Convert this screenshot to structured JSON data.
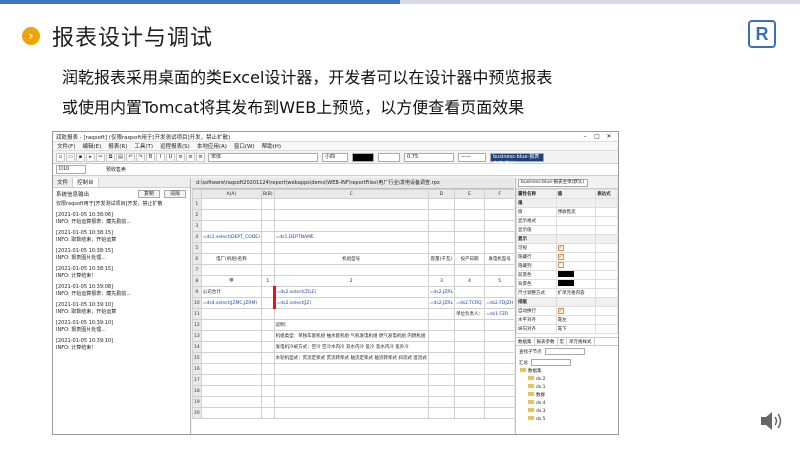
{
  "slide": {
    "title": "报表设计与调试",
    "line1": "润乾报表采用桌面的类Excel设计器，开发者可以在设计器中预览报表",
    "line2": "或使用内置Tomcat将其发布到WEB上预览，以方便查看页面效果",
    "logo_letter": "R",
    "bullet_icon": "chevron-right"
  },
  "app": {
    "title": "润乾报表 - [raqsoft] (仅限raqsoft用于[开发测试项目]开发，禁止扩散)",
    "menu": [
      "文件(F)",
      "编辑(E)",
      "报表(R)",
      "工具(T)",
      "远程报表(S)",
      "本地应用(A)",
      "窗口(W)",
      "帮助(H)"
    ],
    "font": "宋体",
    "font_size": "小四",
    "line_width": "0.75",
    "cell_ref": "D10",
    "formula_text": "预收售卖",
    "left_tabs": [
      "文件",
      "控制台"
    ],
    "system_output": "系统信息输出",
    "copy_btn": "复制",
    "clear_btn": "清除",
    "log_intro": "仅限raqsoft用于[开发测试项目]开发，禁止扩散",
    "log": [
      {
        "time": "[2021-01-05 10:38:06]",
        "msg": "INFO: 开始运算报表：藏先勤前..."
      },
      {
        "time": "[2021-01-05 10:38:15]",
        "msg": "INFO: 取数结束，开始运算"
      },
      {
        "time": "[2021-01-05 10:38:15]",
        "msg": "INFO: 报表图片处理..."
      },
      {
        "time": "[2021-01-05 10:38:15]",
        "msg": "INFO: 计算结束！"
      },
      {
        "time": "[2021-01-05 10:39:08]",
        "msg": "INFO: 开始运算报表：藏先勤前..."
      },
      {
        "time": "[2021-01-05 10:39:10]",
        "msg": "INFO: 取数结束，开始运算"
      },
      {
        "time": "[2021-01-05 10:39:10]",
        "msg": "INFO: 报表图片处理..."
      },
      {
        "time": "[2021-01-05 10:39:10]",
        "msg": "INFO: 计算结束！"
      }
    ],
    "path": "d:\\software\\raqsoft20201124\\report\\webapps\\demo\\WEB-INF\\reportFiles\\电厂行业\\发电设备调查.rpx",
    "columns": [
      "A(A)",
      "B(B)",
      "C",
      "D",
      "E",
      "F",
      "G",
      "H"
    ],
    "rows": [
      {
        "n": "1",
        "cells": [
          "",
          "",
          "",
          "",
          "",
          "",
          "",
          ""
        ]
      },
      {
        "n": "2",
        "cells": [
          "",
          "",
          "",
          "",
          "",
          "",
          "",
          ""
        ]
      },
      {
        "n": "3",
        "cells": [
          "",
          "",
          "",
          "",
          "",
          "",
          "",
          ""
        ]
      },
      {
        "n": "4",
        "cells": [
          "=ds1.select(DEPT_CODE)",
          "",
          "=ds1.DEPTNAME",
          "",
          "",
          "",
          "3'+ds1.(2)",
          ""
        ]
      },
      {
        "n": "5",
        "cells": [
          "",
          "",
          "",
          "",
          "",
          "",
          "",
          ""
        ]
      },
      {
        "n": "6",
        "cells": [
          "电厂(机组)名称",
          "",
          "机组型号",
          "容量(千瓦)",
          "投产日期",
          "发电机型号",
          "发电机冷却方式",
          "发电机制造国家"
        ]
      },
      {
        "n": "7",
        "cells": [
          "",
          "",
          "",
          "",
          "",
          "",
          "",
          ""
        ]
      },
      {
        "n": "8",
        "cells": [
          "甲",
          "1",
          "2",
          "3",
          "4",
          "5",
          "6",
          "7"
        ]
      },
      {
        "n": "9",
        "cells": [
          "公司合计",
          "",
          "=ds2.select(ZILE)",
          "=ds2.JZRL",
          "",
          "",
          "",
          ""
        ]
      },
      {
        "n": "10",
        "cells": [
          "=ds4.select(JZMC,JZRM)",
          "",
          "=ds2.select(JZ)",
          "=ds2.JZRL",
          "=ds2.TCRQ",
          "=ds2.FDJZH",
          "=ds2.FDJLQ",
          "=ds2.ZZ"
        ]
      },
      {
        "n": "11",
        "cells": [
          "",
          "",
          "",
          "",
          "单位负责人：",
          "=ds1.FZR",
          "",
          ""
        ]
      },
      {
        "n": "12",
        "cells": [
          "",
          "",
          "说明：",
          "",
          "",
          "",
          "",
          ""
        ]
      },
      {
        "n": "13",
        "cells": [
          "",
          "",
          "机组类型：单独车套机组 抽水套机组 气机发电机组 燃气发电机组 内燃机组",
          "",
          "",
          "",
          "",
          ""
        ]
      },
      {
        "n": "14",
        "cells": [
          "",
          "",
          "发电机冷却方式：空冷 空冷水内冷 双水内冷 氢冷 氢水内冷 氢外冷",
          "",
          "",
          "",
          "",
          ""
        ]
      },
      {
        "n": "15",
        "cells": [
          "",
          "",
          "水轮机型式：贯流定桨式 贯流转桨式 轴流定桨式 轴流转桨式 斜流式 混流式",
          "",
          "",
          "",
          "",
          ""
        ]
      },
      {
        "n": "16",
        "cells": [
          "",
          "",
          "",
          "",
          "",
          "",
          "",
          ""
        ]
      },
      {
        "n": "17",
        "cells": [
          "",
          "",
          "",
          "",
          "",
          "",
          "",
          ""
        ]
      },
      {
        "n": "18",
        "cells": [
          "",
          "",
          "",
          "",
          "",
          "",
          "",
          ""
        ]
      },
      {
        "n": "19",
        "cells": [
          "",
          "",
          "",
          "",
          "",
          "",
          "",
          ""
        ]
      },
      {
        "n": "20",
        "cells": [
          "",
          "",
          "",
          "",
          "",
          "",
          "",
          ""
        ]
      }
    ],
    "style_name": "business-blue-报表主体(默认)",
    "prop_headers": [
      "属性名称",
      "值",
      "表达式"
    ],
    "props": [
      {
        "name": "值",
        "value": "",
        "type": "grp"
      },
      {
        "name": "值",
        "value": "预收售卖",
        "type": "text"
      },
      {
        "name": "显示格式",
        "value": "",
        "type": "text"
      },
      {
        "name": "显示值",
        "value": "",
        "type": "text"
      },
      {
        "name": "显示",
        "value": "",
        "type": "grp"
      },
      {
        "name": "可视",
        "value": "✓",
        "type": "check"
      },
      {
        "name": "隐藏行",
        "value": "✓",
        "type": "check"
      },
      {
        "name": "隐藏列",
        "value": "",
        "type": "check"
      },
      {
        "name": "前景色",
        "value": "",
        "type": "color"
      },
      {
        "name": "背景色",
        "value": "",
        "type": "color"
      },
      {
        "name": "尺寸调整方式",
        "value": "扩单元格内容",
        "type": "text"
      },
      {
        "name": "排版",
        "value": "",
        "type": "grp"
      },
      {
        "name": "自动换行",
        "value": "✓",
        "type": "check"
      },
      {
        "name": "水平对齐",
        "value": "靠左",
        "type": "text"
      },
      {
        "name": "纵向对齐",
        "value": "靠下",
        "type": "text"
      }
    ],
    "right_tabs": [
      "数据集",
      "报表参数",
      "宏",
      "单元格样式"
    ],
    "query_label": "查找子节点",
    "summary_label": "汇总",
    "tree_root": "数据集",
    "tree_items": [
      "ds.2",
      "ds.1",
      "数群",
      "ds.4",
      "ds.3",
      "ds.5"
    ]
  }
}
